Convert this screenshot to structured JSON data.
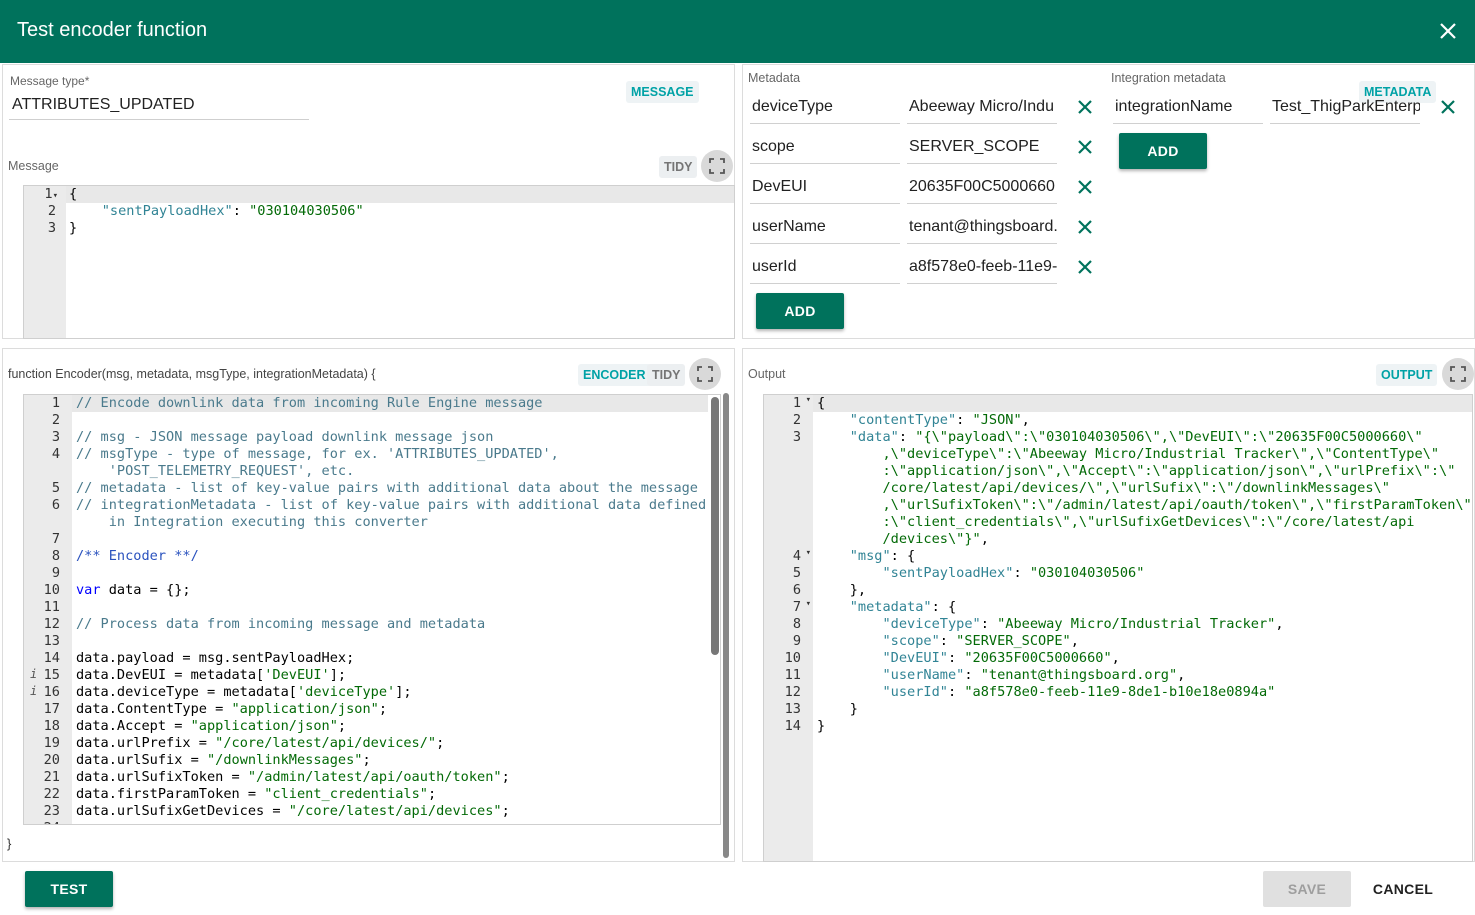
{
  "dialog": {
    "title": "Test encoder function",
    "close_icon": "close-icon"
  },
  "message_panel": {
    "type_label": "Message type",
    "type_required_mark": "*",
    "type_value": "ATTRIBUTES_UPDATED",
    "type_chip": "MESSAGE",
    "message_label": "Message",
    "tidy": "TIDY",
    "lines": [
      {
        "n": "1",
        "fold": "▾",
        "text": "{"
      },
      {
        "n": "2",
        "key": "\"sentPayloadHex\"",
        "sep": ": ",
        "val": "\"030104030506\""
      },
      {
        "n": "3",
        "text": "}"
      }
    ]
  },
  "metadata_panel": {
    "label": "Metadata",
    "rows": [
      {
        "key": "deviceType",
        "value": "Abeeway Micro/Indu"
      },
      {
        "key": "scope",
        "value": "SERVER_SCOPE"
      },
      {
        "key": "DevEUI",
        "value": "20635F00C5000660"
      },
      {
        "key": "userName",
        "value": "tenant@thingsboard."
      },
      {
        "key": "userId",
        "value": "a8f578e0-feeb-11e9-"
      }
    ],
    "add": "ADD"
  },
  "integration_panel": {
    "label": "Integration metadata",
    "chip": "METADATA",
    "rows": [
      {
        "key": "integrationName",
        "value": "Test_ThigParkEnterp"
      }
    ],
    "add": "ADD"
  },
  "encoder_panel": {
    "signature": "function Encoder(msg, metadata, msgType, integrationMetadata) {",
    "chip": "ENCODER",
    "tidy": "TIDY",
    "closing": "}",
    "lines": [
      {
        "n": "1",
        "html": "<span class='c'>// Encode downlink data from incoming Rule Engine message</span>"
      },
      {
        "n": "2",
        "html": ""
      },
      {
        "n": "3",
        "html": "<span class='c'>// msg - JSON message payload downlink message json</span>"
      },
      {
        "n": "4",
        "html": "<span class='c'>// msgType - type of message, for ex. 'ATTRIBUTES_UPDATED',</span>"
      },
      {
        "n": "",
        "html": "<span class='c'>    'POST_TELEMETRY_REQUEST', etc.</span>"
      },
      {
        "n": "5",
        "html": "<span class='c'>// metadata - list of key-value pairs with additional data about the message</span>"
      },
      {
        "n": "6",
        "html": "<span class='c'>// integrationMetadata - list of key-value pairs with additional data defined</span>"
      },
      {
        "n": "",
        "html": "<span class='c'>    in Integration executing this converter</span>"
      },
      {
        "n": "7",
        "html": ""
      },
      {
        "n": "8",
        "html": "<span class='doc'>/** Encoder **/</span>"
      },
      {
        "n": "9",
        "html": ""
      },
      {
        "n": "10",
        "html": "<span class='kw'>var</span> data = {};"
      },
      {
        "n": "11",
        "html": ""
      },
      {
        "n": "12",
        "html": "<span class='c'>// Process data from incoming message and metadata</span>"
      },
      {
        "n": "13",
        "html": ""
      },
      {
        "n": "14",
        "html": "data.payload = msg.sentPayloadHex;"
      },
      {
        "n": "15",
        "info": "i",
        "html": "data.DevEUI = metadata[<span class='str'>'DevEUI'</span>];"
      },
      {
        "n": "16",
        "info": "i",
        "html": "data.deviceType = metadata[<span class='str'>'deviceType'</span>];"
      },
      {
        "n": "17",
        "html": "data.ContentType = <span class='str'>\"application/json\"</span>;"
      },
      {
        "n": "18",
        "html": "data.Accept = <span class='str'>\"application/json\"</span>;"
      },
      {
        "n": "19",
        "html": "data.urlPrefix = <span class='str'>\"/core/latest/api/devices/\"</span>;"
      },
      {
        "n": "20",
        "html": "data.urlSufix = <span class='str'>\"/downlinkMessages\"</span>;"
      },
      {
        "n": "21",
        "html": "data.urlSufixToken = <span class='str'>\"/admin/latest/api/oauth/token\"</span>;"
      },
      {
        "n": "22",
        "html": "data.firstParamToken = <span class='str'>\"client_credentials\"</span>;"
      },
      {
        "n": "23",
        "html": "data.urlSufixGetDevices = <span class='str'>\"/core/latest/api/devices\"</span>;"
      },
      {
        "n": "24",
        "html": ""
      }
    ]
  },
  "output_panel": {
    "label": "Output",
    "chip": "OUTPUT",
    "lines": [
      {
        "n": "1",
        "fold": "▾",
        "html": "{"
      },
      {
        "n": "2",
        "html": "    <span class='key'>\"contentType\"</span>: <span class='str'>\"JSON\"</span>,"
      },
      {
        "n": "3",
        "html": "    <span class='key'>\"data\"</span>: <span class='str'>\"{\\\"payload\\\":\\\"030104030506\\\",\\\"DevEUI\\\":\\\"20635F00C5000660\\\"</span>"
      },
      {
        "n": "",
        "html": "        <span class='str'>,\\\"deviceType\\\":\\\"Abeeway Micro/Industrial Tracker\\\",\\\"ContentType\\\"</span>"
      },
      {
        "n": "",
        "html": "        <span class='str'>:\\\"application/json\\\",\\\"Accept\\\":\\\"application/json\\\",\\\"urlPrefix\\\":\\\"</span>"
      },
      {
        "n": "",
        "html": "        <span class='str'>/core/latest/api/devices/\\\",\\\"urlSufix\\\":\\\"/downlinkMessages\\\"</span>"
      },
      {
        "n": "",
        "html": "        <span class='str'>,\\\"urlSufixToken\\\":\\\"/admin/latest/api/oauth/token\\\",\\\"firstParamToken\\\"</span>"
      },
      {
        "n": "",
        "html": "        <span class='str'>:\\\"client_credentials\\\",\\\"urlSufixGetDevices\\\":\\\"/core/latest/api</span>"
      },
      {
        "n": "",
        "html": "        <span class='str'>/devices\\\"}\"</span>,"
      },
      {
        "n": "4",
        "fold": "▾",
        "html": "    <span class='key'>\"msg\"</span>: {"
      },
      {
        "n": "5",
        "html": "        <span class='key'>\"sentPayloadHex\"</span>: <span class='str'>\"030104030506\"</span>"
      },
      {
        "n": "6",
        "html": "    },"
      },
      {
        "n": "7",
        "fold": "▾",
        "html": "    <span class='key'>\"metadata\"</span>: {"
      },
      {
        "n": "8",
        "html": "        <span class='key'>\"deviceType\"</span>: <span class='str'>\"Abeeway Micro/Industrial Tracker\"</span>,"
      },
      {
        "n": "9",
        "html": "        <span class='key'>\"scope\"</span>: <span class='str'>\"SERVER_SCOPE\"</span>,"
      },
      {
        "n": "10",
        "html": "        <span class='key'>\"DevEUI\"</span>: <span class='str'>\"20635F00C5000660\"</span>,"
      },
      {
        "n": "11",
        "html": "        <span class='key'>\"userName\"</span>: <span class='str'>\"tenant@thingsboard.org\"</span>,"
      },
      {
        "n": "12",
        "html": "        <span class='key'>\"userId\"</span>: <span class='str'>\"a8f578e0-feeb-11e9-8de1-b10e18e0894a\"</span>"
      },
      {
        "n": "13",
        "html": "    }"
      },
      {
        "n": "14",
        "html": "}"
      }
    ]
  },
  "footer": {
    "test": "TEST",
    "save": "SAVE",
    "cancel": "CANCEL"
  },
  "colors": {
    "primary": "#00725c",
    "chip_text": "#00a2a6"
  }
}
